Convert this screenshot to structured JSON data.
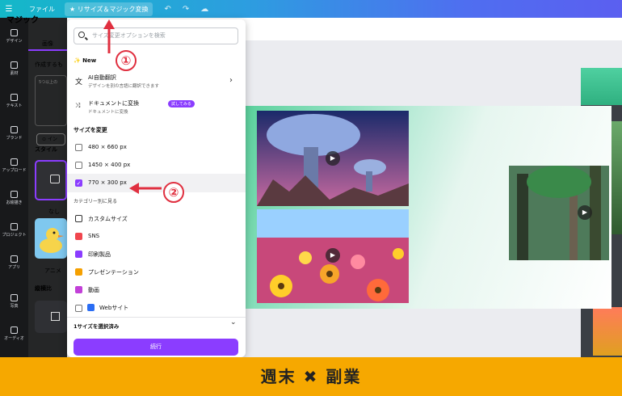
{
  "topbar": {
    "menu_icon": "hamburger-icon",
    "file": "ファイル",
    "resize_btn": "リサイズ＆マジック変換",
    "undo_icon": "undo-icon",
    "redo_icon": "redo-icon",
    "cloud_icon": "cloud-save-icon"
  },
  "rail": {
    "items": [
      {
        "label": "デザイン",
        "icon": "design-icon"
      },
      {
        "label": "素材",
        "icon": "elements-icon"
      },
      {
        "label": "テキスト",
        "icon": "text-icon"
      },
      {
        "label": "ブランド",
        "icon": "brand-icon"
      },
      {
        "label": "アップロード",
        "icon": "upload-icon"
      },
      {
        "label": "お絵描き",
        "icon": "draw-icon"
      },
      {
        "label": "プロジェクト",
        "icon": "folder-icon"
      },
      {
        "label": "アプリ",
        "icon": "apps-icon"
      },
      {
        "label": "写真",
        "icon": "photo-icon"
      },
      {
        "label": "オーディオ",
        "icon": "audio-icon"
      }
    ]
  },
  "panel": {
    "title": "マジック",
    "tab": "画像",
    "subtitle": "作成するも",
    "box_text": "5つ以上の",
    "ins": "イン",
    "style": "スタイル",
    "none": "なし",
    "anime": "アニメ",
    "ratio": "縦横比"
  },
  "dropdown": {
    "search_placeholder": "サイズ変更オプションを検索",
    "new_label": "✨ New",
    "translate_title": "AI自動翻訳",
    "translate_desc": "デザインを別の言語に翻訳できます",
    "convert_title": "ドキュメントに変換",
    "convert_badge": "試してみる",
    "convert_desc": "ドキュメントに変換",
    "resize_heading": "サイズを変更",
    "sizes": [
      {
        "label": "480 × 660 px",
        "checked": false
      },
      {
        "label": "1450 × 400 px",
        "checked": false
      },
      {
        "label": "770 × 300 px",
        "checked": true
      }
    ],
    "category_heading": "カテゴリー別に見る",
    "categories": [
      {
        "label": "カスタムサイズ",
        "icon": "custom-size-icon",
        "color": "#333333"
      },
      {
        "label": "SNS",
        "icon": "heart-icon",
        "color": "#f0464e"
      },
      {
        "label": "印刷製品",
        "icon": "print-icon",
        "color": "#8b3dff"
      },
      {
        "label": "プレゼンテーション",
        "icon": "presentation-icon",
        "color": "#f5a000"
      },
      {
        "label": "動画",
        "icon": "video-icon",
        "color": "#c240d8"
      },
      {
        "label": "Webサイト",
        "icon": "website-icon",
        "color": "#2a6df4"
      }
    ],
    "selected_count": "1サイズを選択済み",
    "continue": "続行"
  },
  "annotations": {
    "circle1": "①",
    "circle2": "②"
  },
  "banner": "週末 ✖ 副業"
}
